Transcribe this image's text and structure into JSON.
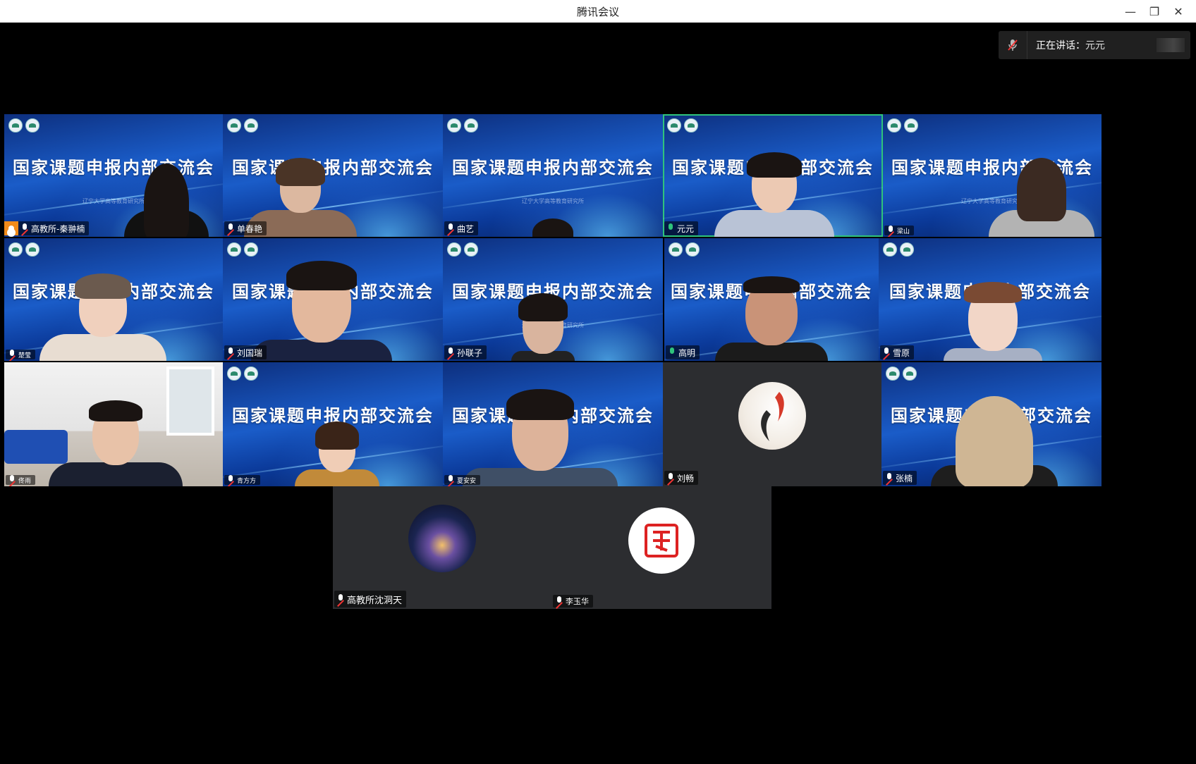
{
  "window": {
    "title": "腾讯会议"
  },
  "speaking": {
    "label": "正在讲话：",
    "name": "元元"
  },
  "banner_text": "国家课题申报内部交流会",
  "sub_text": "辽宁大学高等教育研究所",
  "participants": {
    "p1": "高教所-秦翀楠",
    "p2": "单春艳",
    "p3": "曲艺",
    "p4": "元元",
    "p5": "梁山",
    "p6": "楚莹",
    "p7": "刘国瑞",
    "p8": "孙联子",
    "p9": "高明",
    "p10": "雪原",
    "p11": "佟雨",
    "p12": "青方方",
    "p13": "夏安安",
    "p14": "刘畅",
    "p15": "张楠",
    "p16": "高教所沈洞天",
    "p17": "李玉华"
  },
  "icons": {
    "minimize": "minimize-icon",
    "restore": "restore-icon",
    "close": "close-icon",
    "mic_muted": "mic-muted-icon",
    "mic_on": "mic-icon",
    "host": "host-icon"
  }
}
